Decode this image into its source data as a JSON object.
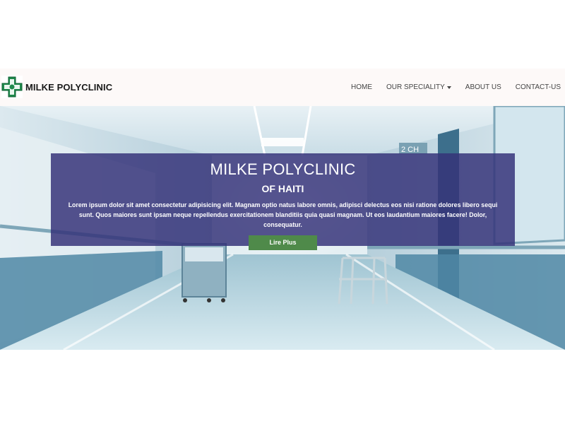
{
  "brand": {
    "name": "MILKE POLYCLINIC",
    "logo_icon": "clinic-cross-logo-icon"
  },
  "nav": {
    "home": "HOME",
    "speciality": "OUR SPECIALITY",
    "about": "ABOUT US",
    "contact": "CONTACT-US"
  },
  "hero": {
    "title": "MILKE POLYCLINIC",
    "subtitle": "OF HAITI",
    "text": "Lorem ipsum dolor sit amet consectetur adipisicing elit. Magnam optio natus labore omnis, adipisci delectus eos nisi ratione dolores libero sequi sunt. Quos maiores sunt ipsam neque repellendus exercitationem blanditiis quia quasi magnam. Ut eos laudantium maiores facere! Dolor, consequatur.",
    "button": "Lire Plus",
    "sign": "2 CH"
  },
  "colors": {
    "overlay": "#343278",
    "button": "#4f8a4a",
    "navbar": "#fdf9f8"
  }
}
